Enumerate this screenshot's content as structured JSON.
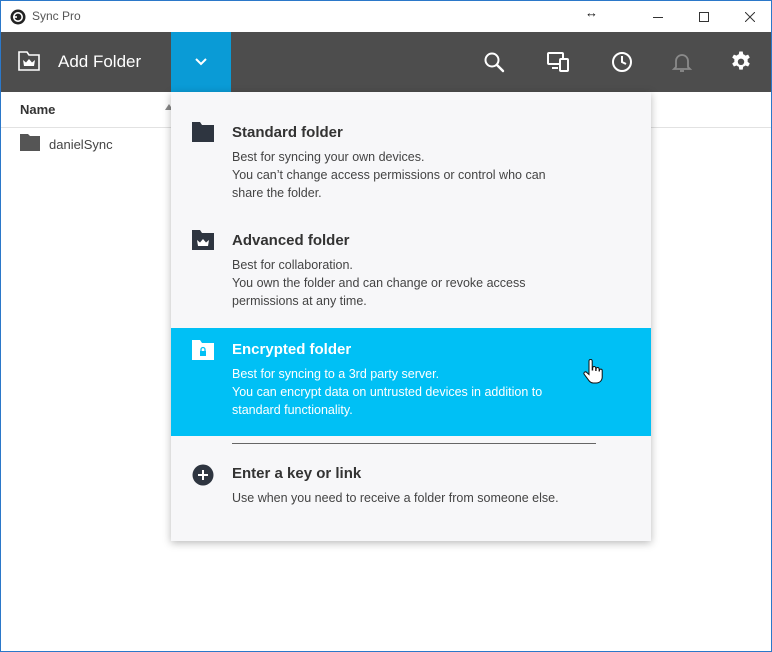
{
  "window": {
    "title": "Sync Pro"
  },
  "toolbar": {
    "add_folder_label": "Add Folder",
    "icons": [
      "search-icon",
      "devices-icon",
      "history-icon",
      "notifications-icon",
      "settings-icon"
    ],
    "accent_color": "#0a9bd6",
    "background_color": "#4d4d4d"
  },
  "list": {
    "column_name": "Name",
    "rows": [
      {
        "name": "danielSync"
      }
    ]
  },
  "menu": {
    "highlight_color": "#00c0f5",
    "items": [
      {
        "title": "Standard folder",
        "desc": [
          "Best for syncing your own devices.",
          "You can’t change access permissions or control who can",
          "share the folder."
        ]
      },
      {
        "title": "Advanced folder",
        "desc": [
          "Best for collaboration.",
          "You own the folder and can change or revoke access",
          "permissions at any time."
        ]
      },
      {
        "title": "Encrypted folder",
        "desc": [
          "Best for syncing to a 3rd party server.",
          "You can encrypt data on untrusted devices in addition to",
          "standard functionality."
        ]
      },
      {
        "title": "Enter a key or link",
        "desc": [
          "Use when you need to receive a folder from someone else."
        ]
      }
    ]
  }
}
